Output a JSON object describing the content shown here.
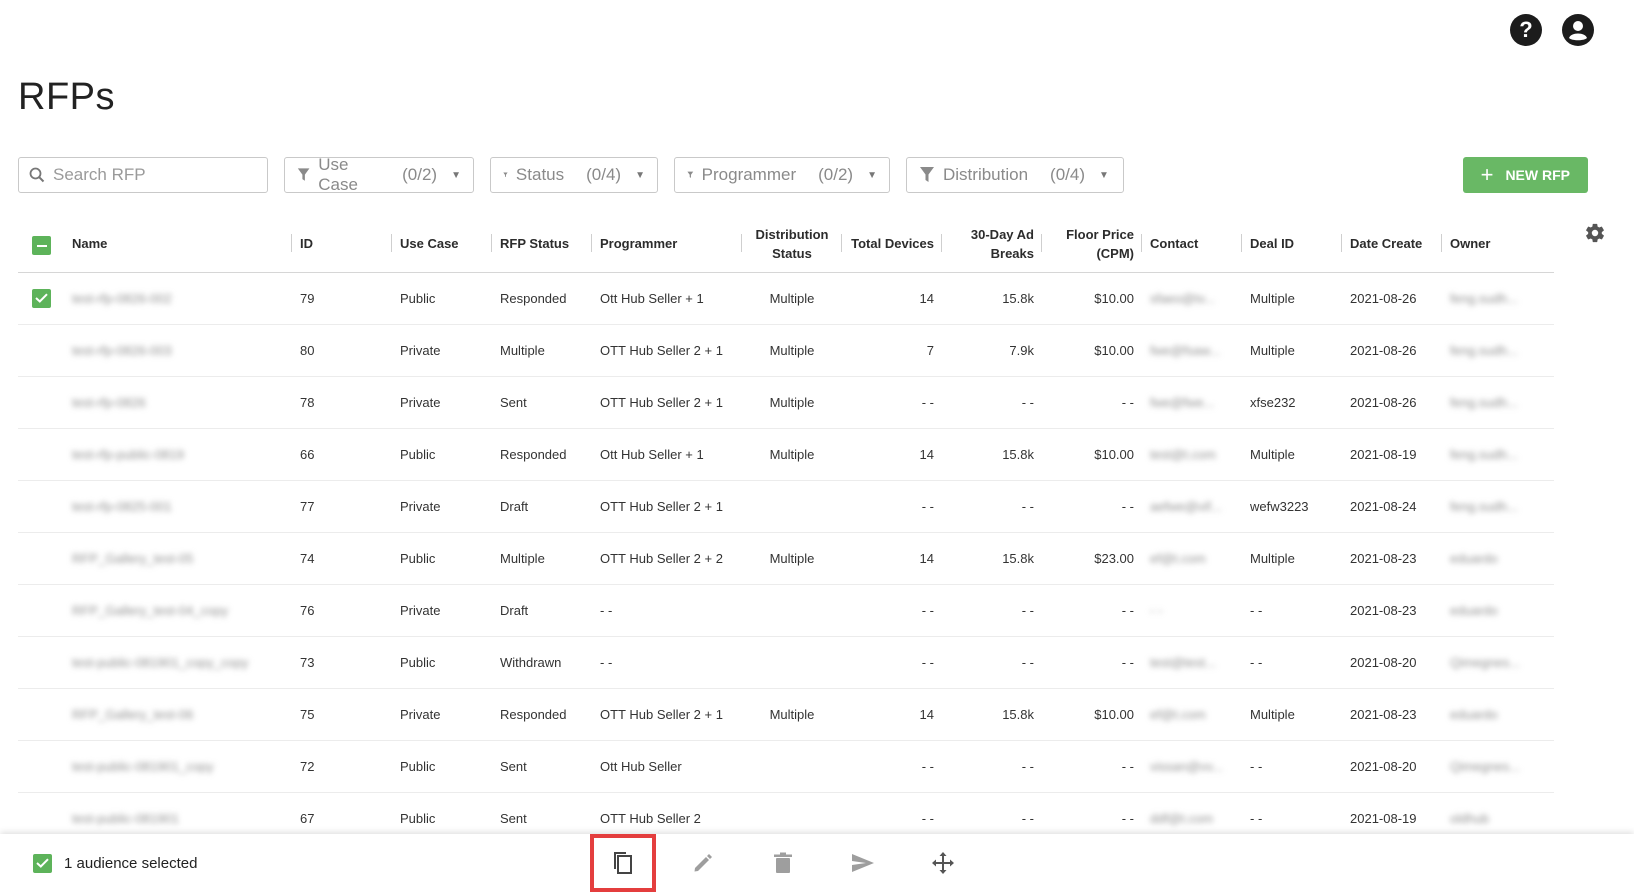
{
  "page": {
    "title": "RFPs"
  },
  "search": {
    "placeholder": "Search RFP"
  },
  "filters": [
    {
      "label": "Use Case",
      "count": "(0/2)"
    },
    {
      "label": "Status",
      "count": "(0/4)"
    },
    {
      "label": "Programmer",
      "count": "(0/2)"
    },
    {
      "label": "Distribution",
      "count": "(0/4)"
    }
  ],
  "new_button": {
    "label": "NEW RFP"
  },
  "columns": {
    "name": "Name",
    "id": "ID",
    "use_case": "Use Case",
    "rfp_status": "RFP Status",
    "programmer": "Programmer",
    "distribution_status": "Distribution Status",
    "total_devices": "Total Devices",
    "ad_breaks": "30-Day Ad Breaks",
    "floor_price": "Floor Price (CPM)",
    "contact": "Contact",
    "deal_id": "Deal ID",
    "date_create": "Date Create",
    "owner": "Owner"
  },
  "rows": [
    {
      "checked": true,
      "name": "test-rfp-0826-002",
      "id": "79",
      "use_case": "Public",
      "status": "Responded",
      "programmer": "Ott Hub Seller + 1",
      "distribution": "Multiple",
      "devices": "14",
      "breaks": "15.8k",
      "price": "$10.00",
      "contact": "sfaeo@tv...",
      "deal": "Multiple",
      "date": "2021-08-26",
      "owner": "feng.sudh..."
    },
    {
      "checked": false,
      "name": "test-rfp-0826-003",
      "id": "80",
      "use_case": "Private",
      "status": "Multiple",
      "programmer": "OTT Hub Seller 2 + 1",
      "distribution": "Multiple",
      "devices": "7",
      "breaks": "7.9k",
      "price": "$10.00",
      "contact": "fwe@fsaw...",
      "deal": "Multiple",
      "date": "2021-08-26",
      "owner": "feng.sudh..."
    },
    {
      "checked": false,
      "name": "test-rfp-0826",
      "id": "78",
      "use_case": "Private",
      "status": "Sent",
      "programmer": "OTT Hub Seller 2 + 1",
      "distribution": "Multiple",
      "devices": "- -",
      "breaks": "- -",
      "price": "- -",
      "contact": "fwe@fwe...",
      "deal": "xfse232",
      "date": "2021-08-26",
      "owner": "feng.sudh..."
    },
    {
      "checked": false,
      "name": "test-rfp-public-0819",
      "id": "66",
      "use_case": "Public",
      "status": "Responded",
      "programmer": "Ott Hub Seller + 1",
      "distribution": "Multiple",
      "devices": "14",
      "breaks": "15.8k",
      "price": "$10.00",
      "contact": "test@t.com",
      "deal": "Multiple",
      "date": "2021-08-19",
      "owner": "feng.sudh..."
    },
    {
      "checked": false,
      "name": "test-rfp-0825-001",
      "id": "77",
      "use_case": "Private",
      "status": "Draft",
      "programmer": "OTT Hub Seller 2 + 1",
      "distribution": "",
      "devices": "- -",
      "breaks": "- -",
      "price": "- -",
      "contact": "aefwe@vif...",
      "deal": "wefw3223",
      "date": "2021-08-24",
      "owner": "feng.sudh..."
    },
    {
      "checked": false,
      "name": "RFP_Gallery_test-05",
      "id": "74",
      "use_case": "Public",
      "status": "Multiple",
      "programmer": "OTT Hub Seller 2 + 2",
      "distribution": "Multiple",
      "devices": "14",
      "breaks": "15.8k",
      "price": "$23.00",
      "contact": "ef@t.com",
      "deal": "Multiple",
      "date": "2021-08-23",
      "owner": "eduardo"
    },
    {
      "checked": false,
      "name": "RFP_Gallery_test-04_copy",
      "id": "76",
      "use_case": "Private",
      "status": "Draft",
      "programmer": "- -",
      "distribution": "",
      "devices": "- -",
      "breaks": "- -",
      "price": "- -",
      "contact": "- -",
      "deal": "- -",
      "date": "2021-08-23",
      "owner": "eduardo"
    },
    {
      "checked": false,
      "name": "test-public-081901_copy_copy",
      "id": "73",
      "use_case": "Public",
      "status": "Withdrawn",
      "programmer": "- -",
      "distribution": "",
      "devices": "- -",
      "breaks": "- -",
      "price": "- -",
      "contact": "test@test...",
      "deal": "- -",
      "date": "2021-08-20",
      "owner": "Qimegnes..."
    },
    {
      "checked": false,
      "name": "RFP_Gallery_test-06",
      "id": "75",
      "use_case": "Private",
      "status": "Responded",
      "programmer": "OTT Hub Seller 2 + 1",
      "distribution": "Multiple",
      "devices": "14",
      "breaks": "15.8k",
      "price": "$10.00",
      "contact": "ef@t.com",
      "deal": "Multiple",
      "date": "2021-08-23",
      "owner": "eduardo"
    },
    {
      "checked": false,
      "name": "test-public-081901_copy",
      "id": "72",
      "use_case": "Public",
      "status": "Sent",
      "programmer": "Ott Hub Seller",
      "distribution": "",
      "devices": "- -",
      "breaks": "- -",
      "price": "- -",
      "contact": "vissan@vv...",
      "deal": "- -",
      "date": "2021-08-20",
      "owner": "Qimegnes..."
    },
    {
      "checked": false,
      "name": "test-public-081901",
      "id": "67",
      "use_case": "Public",
      "status": "Sent",
      "programmer": "OTT Hub Seller 2",
      "distribution": "",
      "devices": "- -",
      "breaks": "- -",
      "price": "- -",
      "contact": "ddf@t.com",
      "deal": "- -",
      "date": "2021-08-19",
      "owner": "oldhub"
    }
  ],
  "bottom_bar": {
    "selected_label": "1 audience selected"
  },
  "icons": {
    "help": "help-icon",
    "account": "account-icon",
    "search": "search-icon",
    "filter": "filter-icon",
    "settings": "gear-icon",
    "copy": "copy-icon",
    "edit": "pencil-icon",
    "delete": "trash-icon",
    "send": "send-icon",
    "move": "move-icon"
  },
  "colors": {
    "accent": "#69b865",
    "highlight": "#e43e3e"
  }
}
